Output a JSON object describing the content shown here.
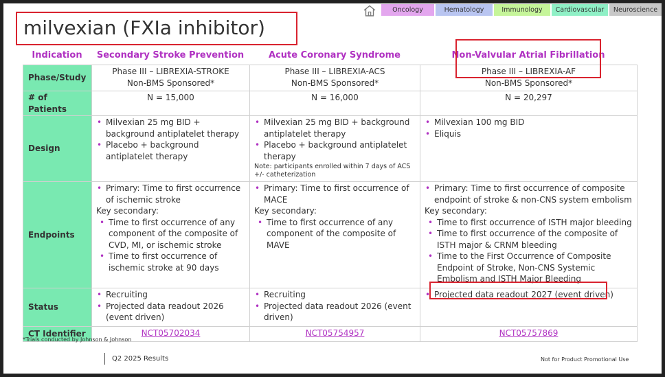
{
  "nav": {
    "tabs": [
      {
        "label": "Oncology",
        "color": "#e3a6ee"
      },
      {
        "label": "Hematology",
        "color": "#b9c5f1"
      },
      {
        "label": "Immunology",
        "color": "#c6f59a"
      },
      {
        "label": "Cardiovascular",
        "color": "#8ff0c6"
      },
      {
        "label": "Neuroscience",
        "color": "#c8c8c8"
      }
    ],
    "home_icon": "home-icon"
  },
  "title": "milvexian (FXIa inhibitor)",
  "columns": {
    "indication": "Indication",
    "c1": "Secondary Stroke Prevention",
    "c2": "Acute Coronary Syndrome",
    "c3": "Non-Valvular Atrial Fibrillation"
  },
  "rows": {
    "phase": {
      "label": "Phase/Study",
      "c1": {
        "study": "Phase III – LIBREXIA-STROKE",
        "sponsor": "Non-BMS Sponsored*"
      },
      "c2": {
        "study": "Phase III – LIBREXIA-ACS",
        "sponsor": "Non-BMS Sponsored*"
      },
      "c3": {
        "study": "Phase III – LIBREXIA-AF",
        "sponsor": "Non-BMS Sponsored*"
      }
    },
    "patients": {
      "label": "# of Patients",
      "c1": "N = 15,000",
      "c2": "N = 16,000",
      "c3": "N = 20,297"
    },
    "design": {
      "label": "Design",
      "c1": [
        "Milvexian 25 mg BID + background antiplatelet therapy",
        "Placebo + background antiplatelet therapy"
      ],
      "c2": [
        "Milvexian 25 mg BID + background antiplatelet therapy",
        "Placebo + background antiplatelet therapy"
      ],
      "c2_note": "Note: participants enrolled within 7 days of ACS +/- catheterization",
      "c3": [
        "Milvexian 100 mg BID",
        "Eliquis"
      ]
    },
    "endpoints": {
      "label": "Endpoints",
      "key_secondary": "Key secondary:",
      "c1": {
        "primary": "Primary: Time to first occurrence of ischemic stroke",
        "secondary": [
          "Time to first occurrence of any component of the composite of CVD, MI, or ischemic stroke",
          "Time to first occurrence of ischemic stroke at 90 days"
        ]
      },
      "c2": {
        "primary": "Primary: Time to first occurrence of MACE",
        "secondary": [
          "Time to first occurrence of any component of the composite of MAVE"
        ]
      },
      "c3": {
        "primary": "Primary: Time to first occurrence of composite endpoint of stroke & non-CNS system embolism",
        "secondary": [
          "Time to first occurrence of ISTH major bleeding",
          "Time to first occurrence of the composite of ISTH major & CRNM bleeding",
          "Time to the First Occurrence of Composite Endpoint of Stroke, Non-CNS Systemic Embolism and ISTH Major Bleeding"
        ]
      }
    },
    "status": {
      "label": "Status",
      "c1": [
        "Recruiting",
        "Projected data readout 2026 (event driven)"
      ],
      "c2": [
        "Recruiting",
        "Projected data readout 2026 (event driven)"
      ],
      "c3": [
        "Projected data readout 2027 (event driven)"
      ]
    },
    "ct": {
      "label": "CT Identifier",
      "c1": "NCT05702034",
      "c2": "NCT05754957",
      "c3": "NCT05757869"
    }
  },
  "footnote": "*Trials conducted by Johnson & Johnson",
  "footer_left": "Q2 2025 Results",
  "footer_right": "Not for Product Promotional Use",
  "colors": {
    "accent": "#b032c2",
    "label_bg": "#79e9b1",
    "highlight_box": "#d9232f"
  }
}
